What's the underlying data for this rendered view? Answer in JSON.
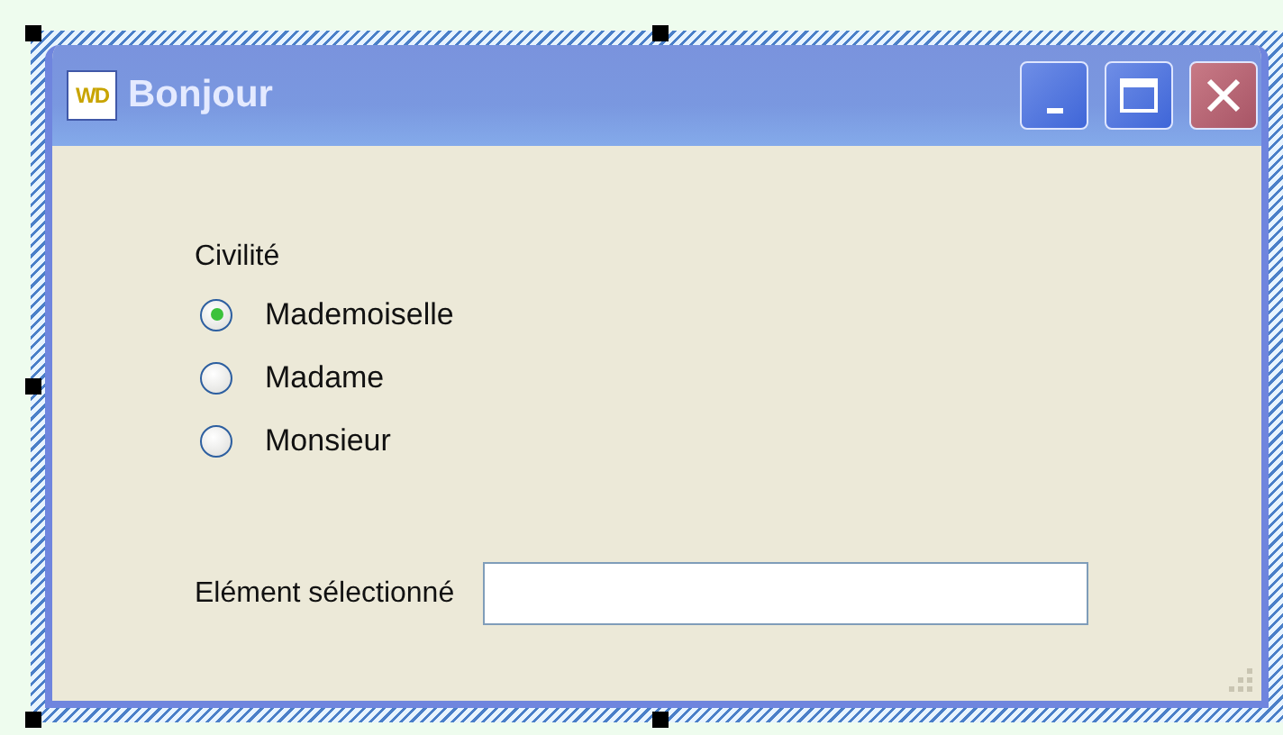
{
  "window": {
    "icon_text": "WD",
    "title": "Bonjour"
  },
  "group": {
    "label": "Civilité",
    "options": [
      {
        "label": "Mademoiselle",
        "selected": true
      },
      {
        "label": "Madame",
        "selected": false
      },
      {
        "label": "Monsieur",
        "selected": false
      }
    ]
  },
  "field": {
    "label": "Elément sélectionné"
  }
}
